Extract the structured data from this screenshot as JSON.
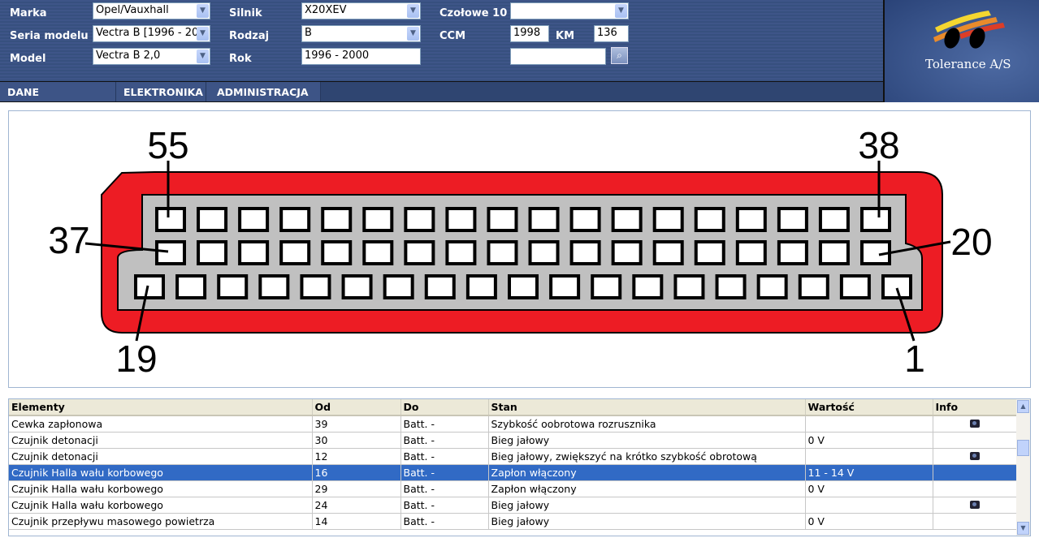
{
  "filters": {
    "marka": {
      "label": "Marka",
      "value": "Opel/Vauxhall"
    },
    "seria": {
      "label": "Seria modelu",
      "value": "Vectra B [1996 - 20"
    },
    "model": {
      "label": "Model",
      "value": "Vectra B 2,0"
    },
    "silnik": {
      "label": "Silnik",
      "value": "X20XEV"
    },
    "rodzaj": {
      "label": "Rodzaj",
      "value": "B"
    },
    "rok": {
      "label": "Rok",
      "value": "1996 - 2000"
    },
    "czolowe": {
      "label": "Czołowe 10",
      "value": ""
    },
    "ccm": {
      "label": "CCM",
      "value": "1998"
    },
    "km": {
      "label": "KM",
      "value": "136"
    },
    "search": {
      "value": ""
    }
  },
  "logo": {
    "name": "Tolerance A/S"
  },
  "nav": [
    "DANE PRZEGLąDU",
    "ELEKTRONIKA",
    "ADMINISTRACJA"
  ],
  "connector": {
    "labels": {
      "tl": "55",
      "tr": "38",
      "ml": "37",
      "mr": "20",
      "bl": "19",
      "br": "1"
    },
    "rows": [
      18,
      18,
      19
    ],
    "colors": {
      "housing": "#ed1c24",
      "insert": "#c0c0c0"
    }
  },
  "table": {
    "headers": [
      "Elementy",
      "Od",
      "Do",
      "Stan",
      "Wartość",
      "Info"
    ],
    "rows": [
      {
        "element": "Cewka zapłonowa",
        "od": "39",
        "do": "Batt. -",
        "stan": "Szybkość oobrotowa rozrusznika",
        "wartosc": "",
        "info": true
      },
      {
        "element": "Czujnik detonacji",
        "od": "30",
        "do": "Batt. -",
        "stan": "Bieg jałowy",
        "wartosc": "0 V",
        "info": false
      },
      {
        "element": "Czujnik detonacji",
        "od": "12",
        "do": "Batt. -",
        "stan": "Bieg jałowy, zwiększyć na krótko szybkość obrotową",
        "wartosc": "",
        "info": true
      },
      {
        "element": "Czujnik Halla wału korbowego",
        "od": "16",
        "do": "Batt. -",
        "stan": "Zapłon włączony",
        "wartosc": "11 - 14 V",
        "info": false,
        "selected": true
      },
      {
        "element": "Czujnik Halla wału korbowego",
        "od": "29",
        "do": "Batt. -",
        "stan": "Zapłon włączony",
        "wartosc": "0 V",
        "info": false
      },
      {
        "element": "Czujnik Halla wału korbowego",
        "od": "24",
        "do": "Batt. -",
        "stan": "Bieg jałowy",
        "wartosc": "",
        "info": true
      },
      {
        "element": "Czujnik przepływu masowego powietrza",
        "od": "14",
        "do": "Batt. -",
        "stan": "Bieg jałowy",
        "wartosc": "0 V",
        "info": false
      }
    ]
  }
}
